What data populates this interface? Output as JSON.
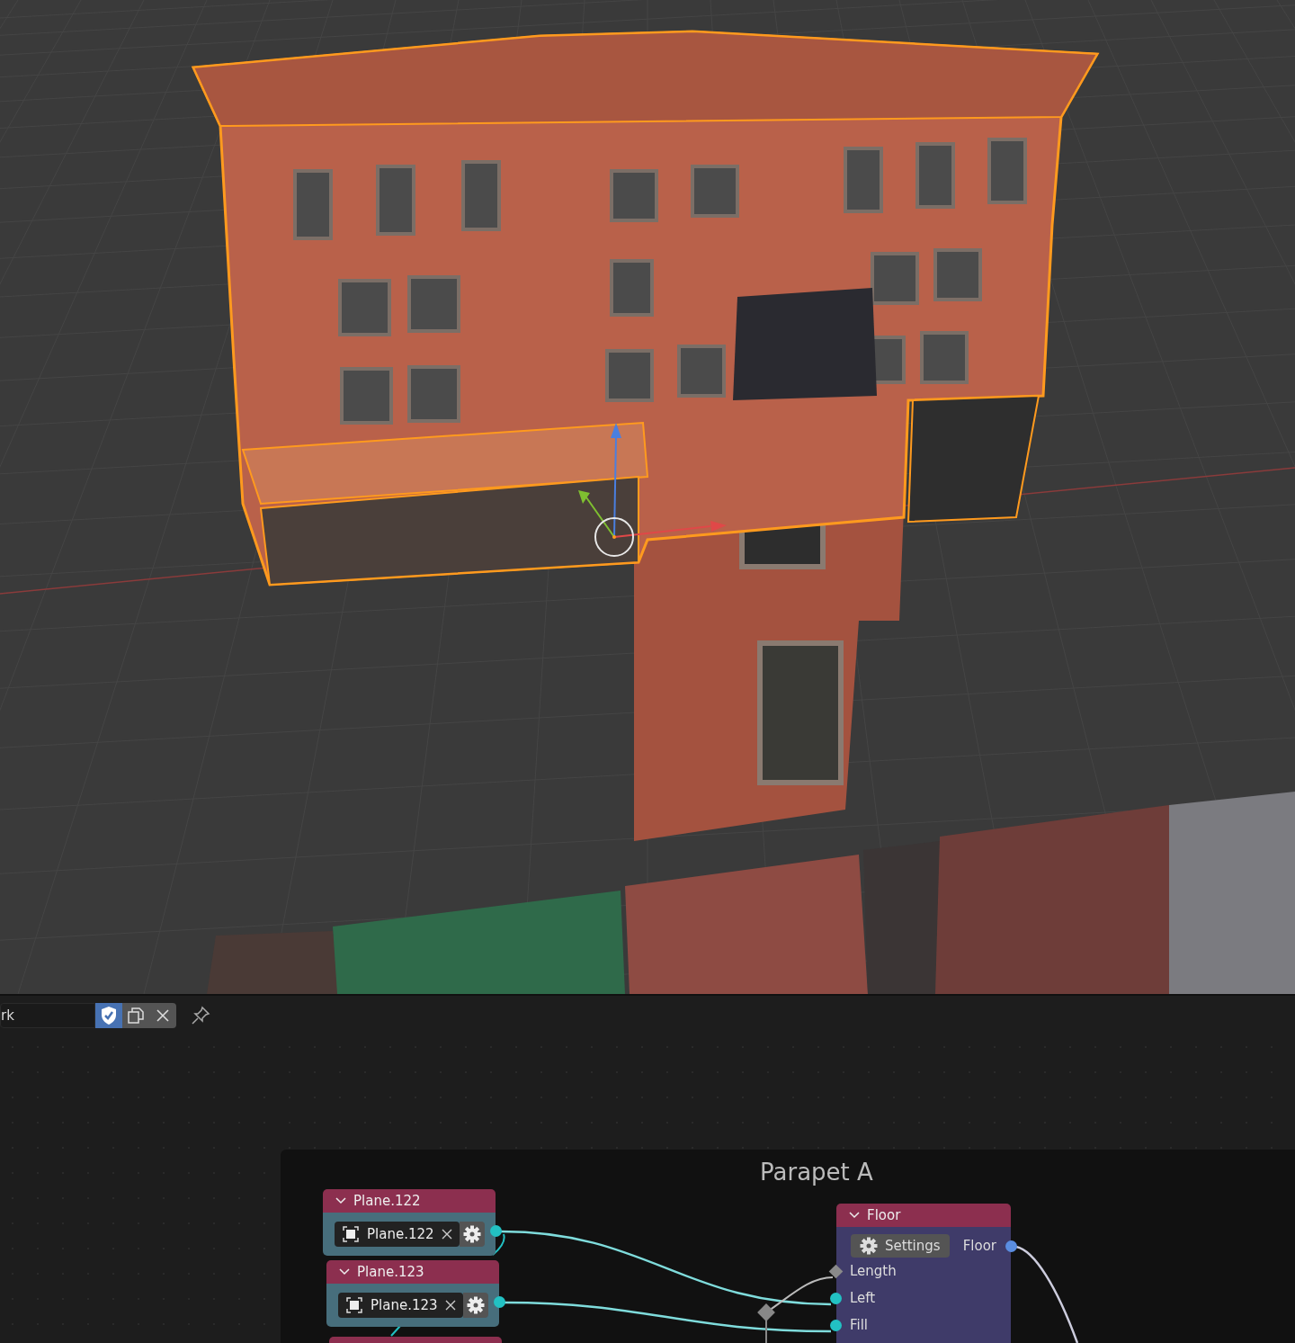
{
  "header": {
    "datablock_field": "rk",
    "fake_user": true
  },
  "node_editor": {
    "frame": {
      "label": "Parapet A"
    },
    "nodes": [
      {
        "kind": "object",
        "title": "Plane.122",
        "object": "Plane.122"
      },
      {
        "kind": "object",
        "title": "Plane.123",
        "object": "Plane.123"
      },
      {
        "kind": "group",
        "title": "Floor",
        "button": "Settings",
        "output": "Floor",
        "inputs": [
          {
            "label": "Length",
            "kind": "diamond"
          },
          {
            "label": "Left",
            "kind": "circle"
          },
          {
            "label": "Fill",
            "kind": "circle"
          }
        ]
      }
    ]
  }
}
